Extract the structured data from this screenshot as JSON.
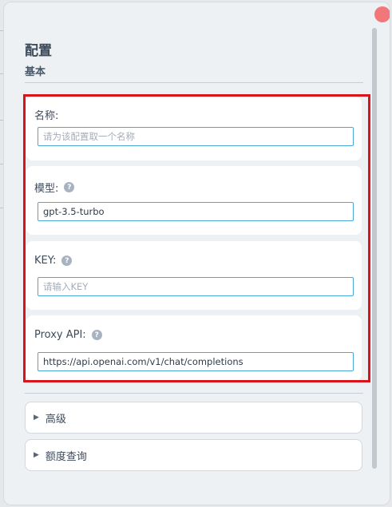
{
  "header": {
    "title": "配置",
    "subtitle": "基本"
  },
  "fields": {
    "name": {
      "label": "名称:",
      "value": "",
      "placeholder": "请为该配置取一个名称"
    },
    "model": {
      "label": "模型:",
      "value": "gpt-3.5-turbo",
      "placeholder": ""
    },
    "key": {
      "label": "KEY:",
      "value": "",
      "placeholder": "请输入KEY"
    },
    "proxy": {
      "label": "Proxy API:",
      "value": "https://api.openai.com/v1/chat/completions",
      "placeholder": ""
    }
  },
  "help_icon_glyph": "?",
  "sections": {
    "advanced": "高级",
    "quota": "额度查询"
  },
  "colors": {
    "highlight": "#d9141b",
    "input_border": "#4aa8d8",
    "close": "#f2777a"
  },
  "icons": {
    "expand": "triangle-right-icon",
    "help": "question-circle-icon",
    "close": "close-dot-icon"
  }
}
